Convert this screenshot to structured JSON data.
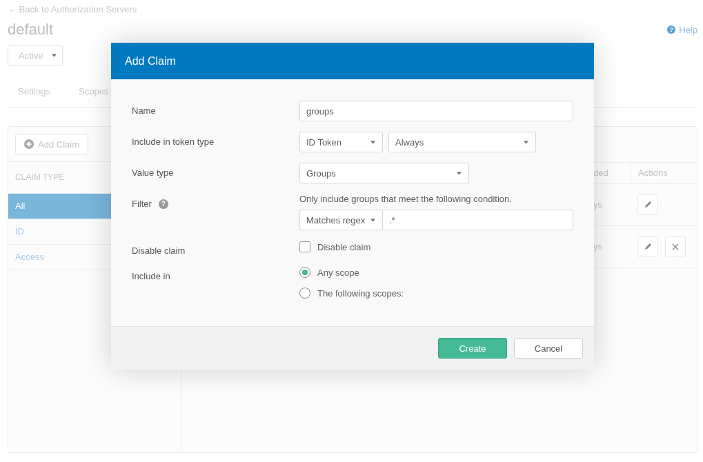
{
  "back_link": "← Back to Authorization Servers",
  "title": "default",
  "status_dropdown": "Active",
  "help_icon": "?",
  "help": "Help",
  "tabs": [
    {
      "label": "Settings",
      "selected": false
    },
    {
      "label": "Scopes",
      "selected": false
    }
  ],
  "sidebar": {
    "add_button": "Add Claim",
    "heading": "CLAIM TYPE",
    "items": [
      {
        "label": "All",
        "selected": true
      },
      {
        "label": "ID",
        "selected": false
      },
      {
        "label": "Access",
        "selected": false
      }
    ]
  },
  "table": {
    "columns": [
      "ded",
      "Actions"
    ],
    "rows": [
      {
        "column_1": "ys",
        "actions": [
          {
            "kind": "edit"
          }
        ]
      },
      {
        "column_1": "ys",
        "actions": [
          {
            "kind": "edit"
          },
          {
            "kind": "delete"
          }
        ]
      }
    ]
  },
  "dialog": {
    "title": "Add Claim",
    "fields": [
      {
        "kind": "text",
        "label": "Name",
        "value": "groups"
      },
      {
        "kind": "selects",
        "label": "Include in token type",
        "selects": [
          "ID Token",
          "Always"
        ]
      },
      {
        "kind": "select",
        "label": "Value type",
        "value": "Groups"
      },
      {
        "kind": "filter",
        "label": "Filter",
        "help_icon": "?",
        "hint": "Only include groups that meet the following condition.",
        "operator": "Matches regex",
        "value": ".*"
      },
      {
        "kind": "checkbox",
        "label": "Disable claim",
        "option": "Disable claim",
        "checked": false
      },
      {
        "kind": "radio",
        "label": "Include in",
        "options": [
          {
            "label": "Any scope",
            "selected": true
          },
          {
            "label": "The following scopes:",
            "selected": false
          }
        ]
      }
    ],
    "buttons": [
      {
        "label": "Create",
        "kind": "primary"
      },
      {
        "label": "Cancel",
        "kind": "secondary"
      }
    ]
  }
}
